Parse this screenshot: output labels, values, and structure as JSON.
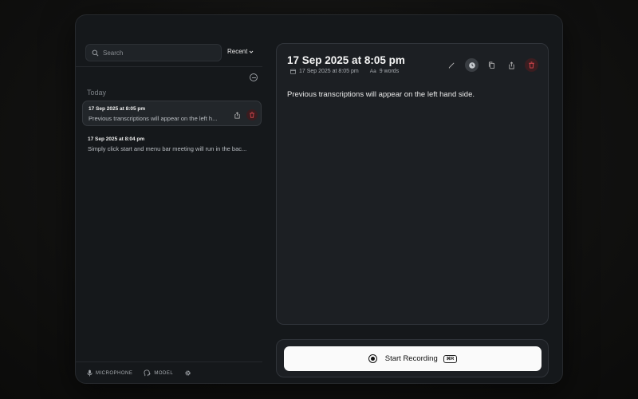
{
  "sidebar": {
    "search": {
      "placeholder": "Search"
    },
    "sort_label": "Recent",
    "group_label": "Today",
    "items": [
      {
        "title": "17 Sep 2025 at 8:05 pm",
        "snippet": "Previous transcriptions will appear on the left h..."
      },
      {
        "title": "17 Sep 2025 at 8:04 pm",
        "snippet": "Simply click start and menu bar meeting will run in the bac..."
      }
    ],
    "footer": {
      "microphone": "MICROPHONE",
      "model": "MODEL"
    }
  },
  "detail": {
    "title": "17 Sep 2025 at 8:05 pm",
    "date": "17 Sep 2025 at 8:05 pm",
    "font_glyph": "Aa",
    "word_count": "9 words",
    "body": "Previous transcriptions will appear on the left hand side."
  },
  "record": {
    "label": "Start Recording",
    "shortcut": "⌘R"
  },
  "colors": {
    "accent_delete": "#e0484f",
    "background": "#15181b",
    "record_button": "#fafafa"
  }
}
